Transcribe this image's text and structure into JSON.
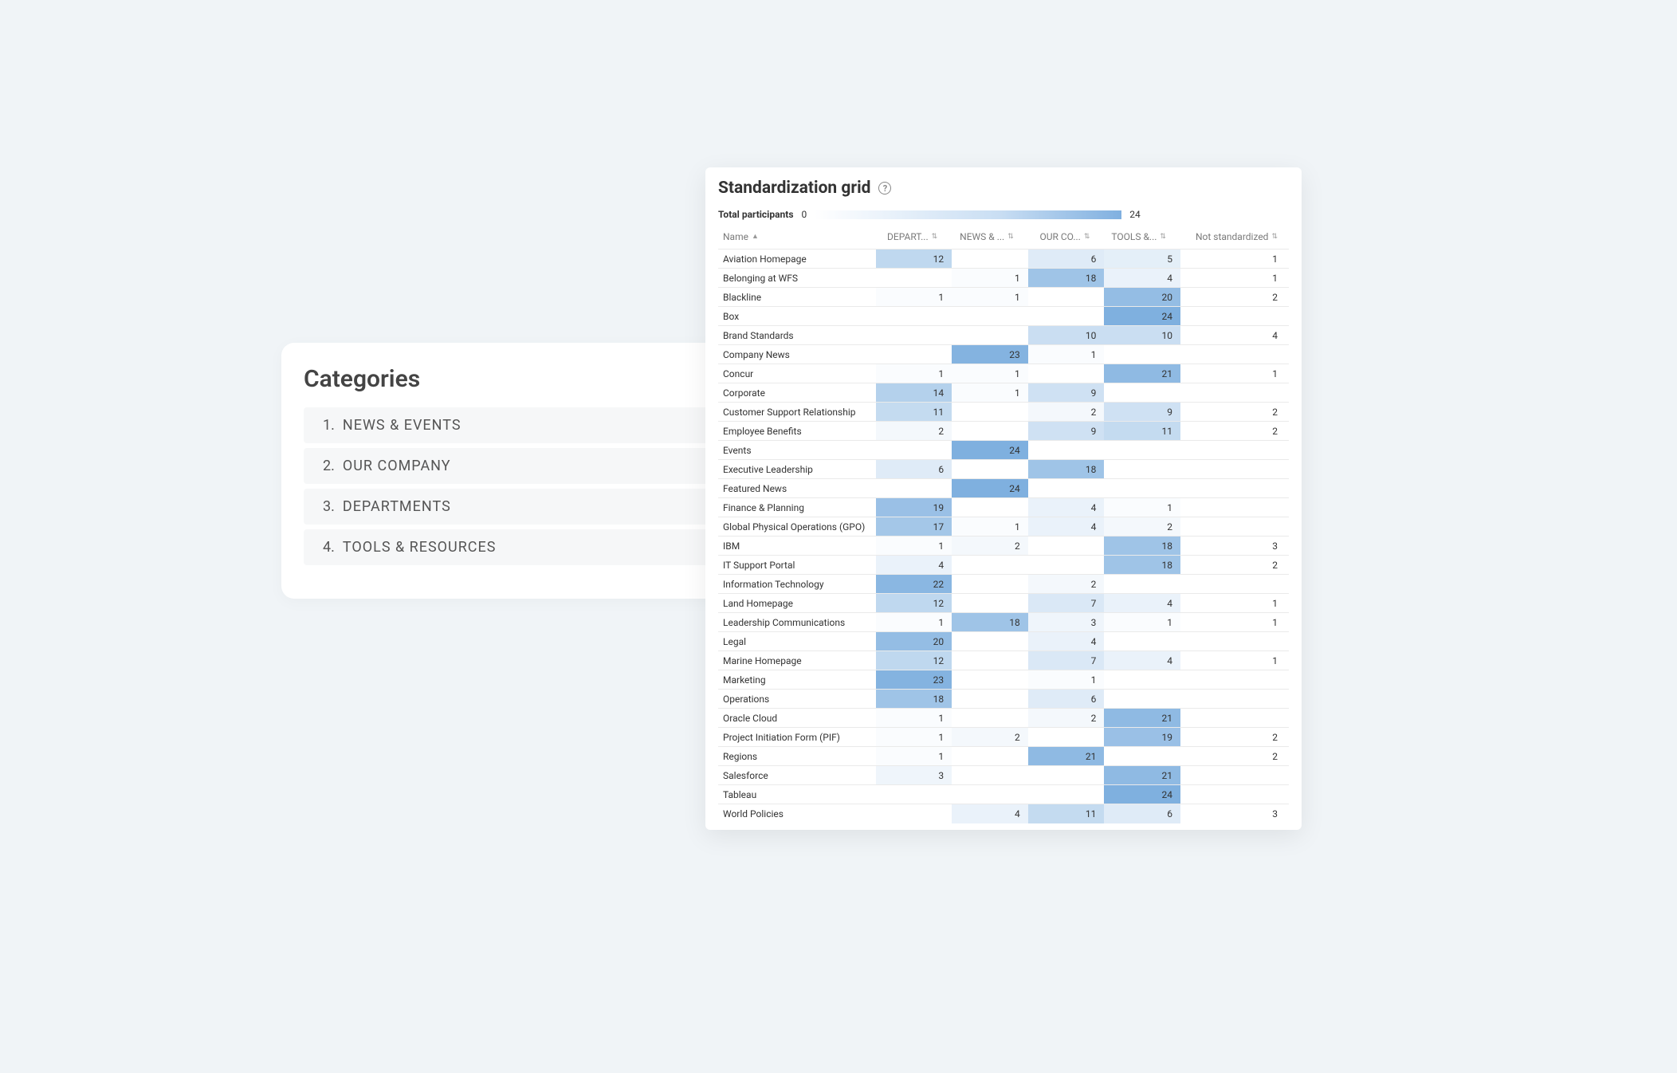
{
  "categories_card": {
    "title": "Categories",
    "items": [
      {
        "num": "1.",
        "label": "NEWS & EVENTS"
      },
      {
        "num": "2.",
        "label": "OUR COMPANY"
      },
      {
        "num": "3.",
        "label": "DEPARTMENTS"
      },
      {
        "num": "4.",
        "label": "TOOLS & RESOURCES"
      }
    ]
  },
  "grid_card": {
    "title": "Standardization grid",
    "help": "?",
    "participants_label": "Total participants",
    "legend_min": "0",
    "legend_max": "24",
    "columns": [
      {
        "key": "name",
        "label": "Name",
        "full": "Name"
      },
      {
        "key": "depart",
        "label": "DEPART...",
        "full": "DEPARTMENTS"
      },
      {
        "key": "news",
        "label": "NEWS & ...",
        "full": "NEWS & EVENTS"
      },
      {
        "key": "ourco",
        "label": "OUR CO...",
        "full": "OUR COMPANY"
      },
      {
        "key": "tools",
        "label": "TOOLS &...",
        "full": "TOOLS & RESOURCES"
      },
      {
        "key": "notstd",
        "label": "Not standardized",
        "full": "Not standardized"
      }
    ]
  },
  "chart_data": {
    "type": "heatmap",
    "title": "Standardization grid",
    "xlabel": "",
    "ylabel": "",
    "value_range": [
      0,
      24
    ],
    "categories": [
      "DEPARTMENTS",
      "NEWS & EVENTS",
      "OUR COMPANY",
      "TOOLS & RESOURCES",
      "Not standardized"
    ],
    "rows": [
      {
        "name": "Aviation Homepage",
        "values": [
          12,
          null,
          6,
          5,
          1
        ]
      },
      {
        "name": "Belonging at WFS",
        "values": [
          null,
          1,
          18,
          4,
          1
        ]
      },
      {
        "name": "Blackline",
        "values": [
          1,
          1,
          null,
          20,
          2
        ]
      },
      {
        "name": "Box",
        "values": [
          null,
          null,
          null,
          24,
          null
        ]
      },
      {
        "name": "Brand Standards",
        "values": [
          null,
          null,
          10,
          10,
          4
        ]
      },
      {
        "name": "Company News",
        "values": [
          null,
          23,
          1,
          null,
          null
        ]
      },
      {
        "name": "Concur",
        "values": [
          1,
          1,
          null,
          21,
          1
        ]
      },
      {
        "name": "Corporate",
        "values": [
          14,
          1,
          9,
          null,
          null
        ]
      },
      {
        "name": "Customer Support Relationship",
        "values": [
          11,
          null,
          2,
          9,
          2
        ]
      },
      {
        "name": "Employee Benefits",
        "values": [
          2,
          null,
          9,
          11,
          2
        ]
      },
      {
        "name": "Events",
        "values": [
          null,
          24,
          null,
          null,
          null
        ]
      },
      {
        "name": "Executive Leadership",
        "values": [
          6,
          null,
          18,
          null,
          null
        ]
      },
      {
        "name": "Featured News",
        "values": [
          null,
          24,
          null,
          null,
          null
        ]
      },
      {
        "name": "Finance & Planning",
        "values": [
          19,
          null,
          4,
          1,
          null
        ]
      },
      {
        "name": "Global Physical Operations (GPO)",
        "values": [
          17,
          1,
          4,
          2,
          null
        ]
      },
      {
        "name": "IBM",
        "values": [
          1,
          2,
          null,
          18,
          3
        ]
      },
      {
        "name": "IT Support Portal",
        "values": [
          4,
          null,
          null,
          18,
          2
        ]
      },
      {
        "name": "Information Technology",
        "values": [
          22,
          null,
          2,
          null,
          null
        ]
      },
      {
        "name": "Land Homepage",
        "values": [
          12,
          null,
          7,
          4,
          1
        ]
      },
      {
        "name": "Leadership Communications",
        "values": [
          1,
          18,
          3,
          1,
          1
        ]
      },
      {
        "name": "Legal",
        "values": [
          20,
          null,
          4,
          null,
          null
        ]
      },
      {
        "name": "Marine Homepage",
        "values": [
          12,
          null,
          7,
          4,
          1
        ]
      },
      {
        "name": "Marketing",
        "values": [
          23,
          null,
          1,
          null,
          null
        ]
      },
      {
        "name": "Operations",
        "values": [
          18,
          null,
          6,
          null,
          null
        ]
      },
      {
        "name": "Oracle Cloud",
        "values": [
          1,
          null,
          2,
          21,
          null
        ]
      },
      {
        "name": "Project Initiation Form (PIF)",
        "values": [
          1,
          2,
          null,
          19,
          2
        ]
      },
      {
        "name": "Regions",
        "values": [
          1,
          null,
          21,
          null,
          2
        ]
      },
      {
        "name": "Salesforce",
        "values": [
          3,
          null,
          null,
          21,
          null
        ]
      },
      {
        "name": "Tableau",
        "values": [
          null,
          null,
          null,
          24,
          null
        ]
      },
      {
        "name": "World Policies",
        "values": [
          null,
          4,
          11,
          6,
          3
        ]
      }
    ]
  }
}
